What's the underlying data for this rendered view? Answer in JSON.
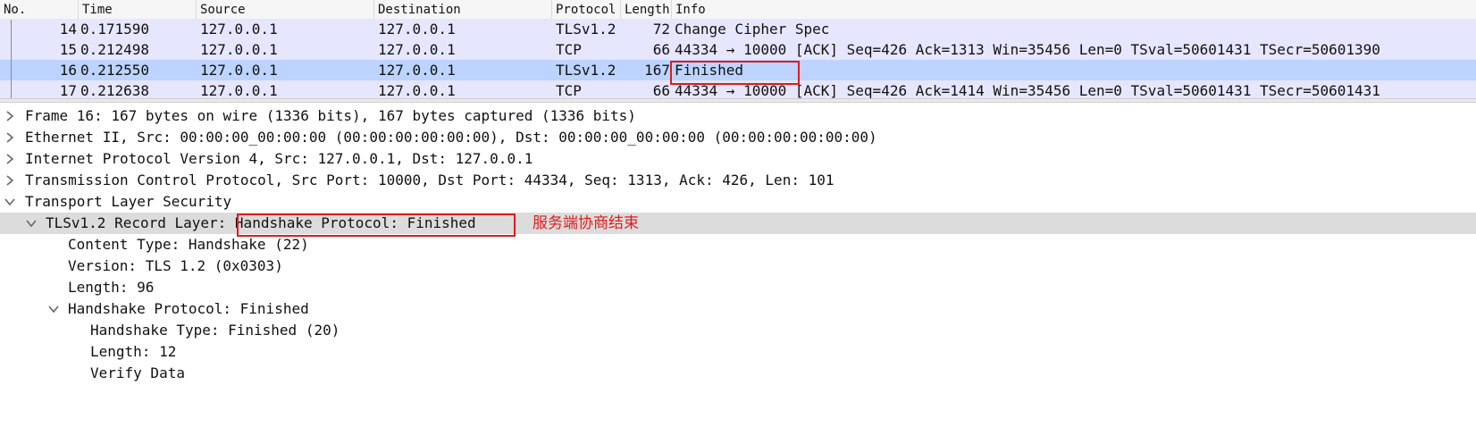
{
  "columns": {
    "no": "No.",
    "time": "Time",
    "source": "Source",
    "destination": "Destination",
    "protocol": "Protocol",
    "length": "Length",
    "info": "Info"
  },
  "packets": [
    {
      "no": "14",
      "time": "0.171590",
      "source": "127.0.0.1",
      "destination": "127.0.0.1",
      "protocol": "TLSv1.2",
      "length": "72",
      "info": "Change Cipher Spec"
    },
    {
      "no": "15",
      "time": "0.212498",
      "source": "127.0.0.1",
      "destination": "127.0.0.1",
      "protocol": "TCP",
      "length": "66",
      "info": "44334 → 10000 [ACK] Seq=426 Ack=1313 Win=35456 Len=0 TSval=50601431 TSecr=50601390"
    },
    {
      "no": "16",
      "time": "0.212550",
      "source": "127.0.0.1",
      "destination": "127.0.0.1",
      "protocol": "TLSv1.2",
      "length": "167",
      "info": "Finished"
    },
    {
      "no": "17",
      "time": "0.212638",
      "source": "127.0.0.1",
      "destination": "127.0.0.1",
      "protocol": "TCP",
      "length": "66",
      "info": "44334 → 10000 [ACK] Seq=426 Ack=1414 Win=35456 Len=0 TSval=50601431 TSecr=50601431"
    }
  ],
  "details": {
    "frame": "Frame 16: 167 bytes on wire (1336 bits), 167 bytes captured (1336 bits)",
    "ethernet": "Ethernet II, Src: 00:00:00_00:00:00 (00:00:00:00:00:00), Dst: 00:00:00_00:00:00 (00:00:00:00:00:00)",
    "ip": "Internet Protocol Version 4, Src: 127.0.0.1, Dst: 127.0.0.1",
    "tcp": "Transmission Control Protocol, Src Port: 10000, Dst Port: 44334, Seq: 1313, Ack: 426, Len: 101",
    "tls": "Transport Layer Security",
    "record_prefix": "TLSv1.2 Record Layer: ",
    "record_suffix": "Handshake Protocol: Finished",
    "content_type": "Content Type: Handshake (22)",
    "version": "Version: TLS 1.2 (0x0303)",
    "length": "Length: 96",
    "handshake": "Handshake Protocol: Finished",
    "handshake_type": "Handshake Type: Finished (20)",
    "handshake_length": "Length: 12",
    "verify_data": "Verify Data"
  },
  "annotation": "服务端协商结束",
  "colors": {
    "row_bg": "#e7e6ff",
    "selected_bg": "#bcd4ff",
    "highlight_box": "#e01b1b"
  }
}
